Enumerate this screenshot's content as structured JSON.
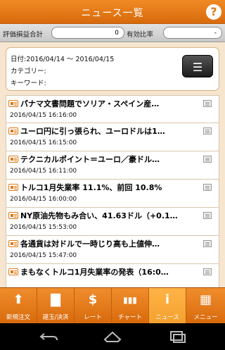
{
  "header": {
    "title": "ニュース一覧",
    "help": "?"
  },
  "summary": {
    "pl_label": "評価損益合計",
    "pl_value": "0",
    "margin_label": "有効比率",
    "margin_value": "-"
  },
  "search": {
    "date_label": "日付:",
    "date_value": "2016/04/14 ～ 2016/04/15",
    "category_label": "カテゴリー:",
    "keyword_label": "キーワード:",
    "menu_glyph": "☰"
  },
  "news": [
    {
      "title": "パナマ文書問題でソリア・スペイン産…",
      "date": "2016/04/15 16:16:00"
    },
    {
      "title": "ユーロ円に引っ張られ、ユーロドルは1…",
      "date": "2016/04/15 16:15:00"
    },
    {
      "title": "テクニカルポイント＝ユーロ／豪ドル…",
      "date": "2016/04/15 16:11:00"
    },
    {
      "title": "トルコ1月失業率 11.1%、前回 10.8%",
      "date": "2016/04/15 16:00:00"
    },
    {
      "title": "NY原油先物もみ合い、41.63ドル（+0.1…",
      "date": "2016/04/15 15:53:00"
    },
    {
      "title": "各通貨は対ドルで一時じり高も上値伸…",
      "date": "2016/04/15 15:47:00"
    },
    {
      "title": "まもなくトルコ1月失業率の発表（16:0…",
      "date": ""
    }
  ],
  "tabs": [
    {
      "label": "新規注文",
      "icon": "⬆"
    },
    {
      "label": "建玉/決済",
      "icon": "▇"
    },
    {
      "label": "レート",
      "icon": "$"
    },
    {
      "label": "チャート",
      "icon": "▮▮▮"
    },
    {
      "label": "ニュース",
      "icon": "i"
    },
    {
      "label": "メニュー",
      "icon": "▦"
    }
  ],
  "colors": {
    "accent": "#e07814",
    "background": "#f6e6cf"
  }
}
